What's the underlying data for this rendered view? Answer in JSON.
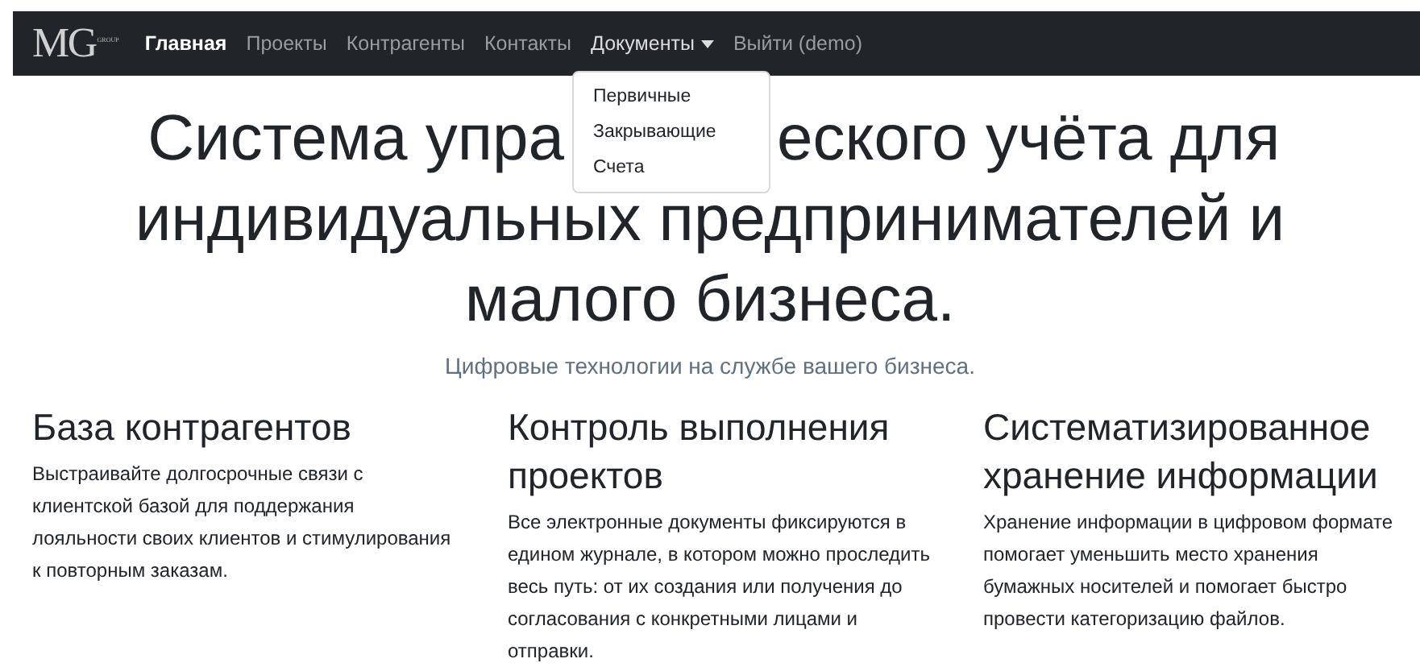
{
  "navbar": {
    "logo": {
      "letters": "MG",
      "small": "GROUP"
    },
    "items": [
      {
        "label": "Главная",
        "selected": true,
        "kind": "link"
      },
      {
        "label": "Проекты",
        "selected": false,
        "kind": "link"
      },
      {
        "label": "Контрагенты",
        "selected": false,
        "kind": "link"
      },
      {
        "label": "Контакты",
        "selected": false,
        "kind": "link"
      },
      {
        "label": "Документы",
        "selected": false,
        "kind": "dropdown",
        "expanded": true,
        "menu": [
          "Первичные",
          "Закрывающие",
          "Счета"
        ]
      },
      {
        "label": "Выйти (demo)",
        "selected": false,
        "kind": "link"
      }
    ]
  },
  "hero": {
    "title_lines": [
      [
        "Система упра",
        "еского учёта для"
      ],
      [
        "индивидуальных предпринимателей и"
      ],
      [
        "малого бизнеса."
      ]
    ],
    "subtitle": "Цифровые технологии на службе вашего бизнеса."
  },
  "features": [
    {
      "title": "База контрагентов",
      "text": "Выстраивайте долгосрочные связи с клиентской базой для поддержания лояльности своих клиентов и стимулирования к повторным заказам."
    },
    {
      "title": "Контроль выполнения проектов",
      "text": "Все электронные документы фиксируются в едином журнале, в котором можно проследить весь путь: от их создания или получения до согласования с конкретными лицами и отправки."
    },
    {
      "title": "Систематизированное хранение информации",
      "text": "Хранение информации в цифровом формате помогает уменьшить место хранения бумажных носителей и помогает быстро провести категоризацию файлов."
    }
  ]
}
